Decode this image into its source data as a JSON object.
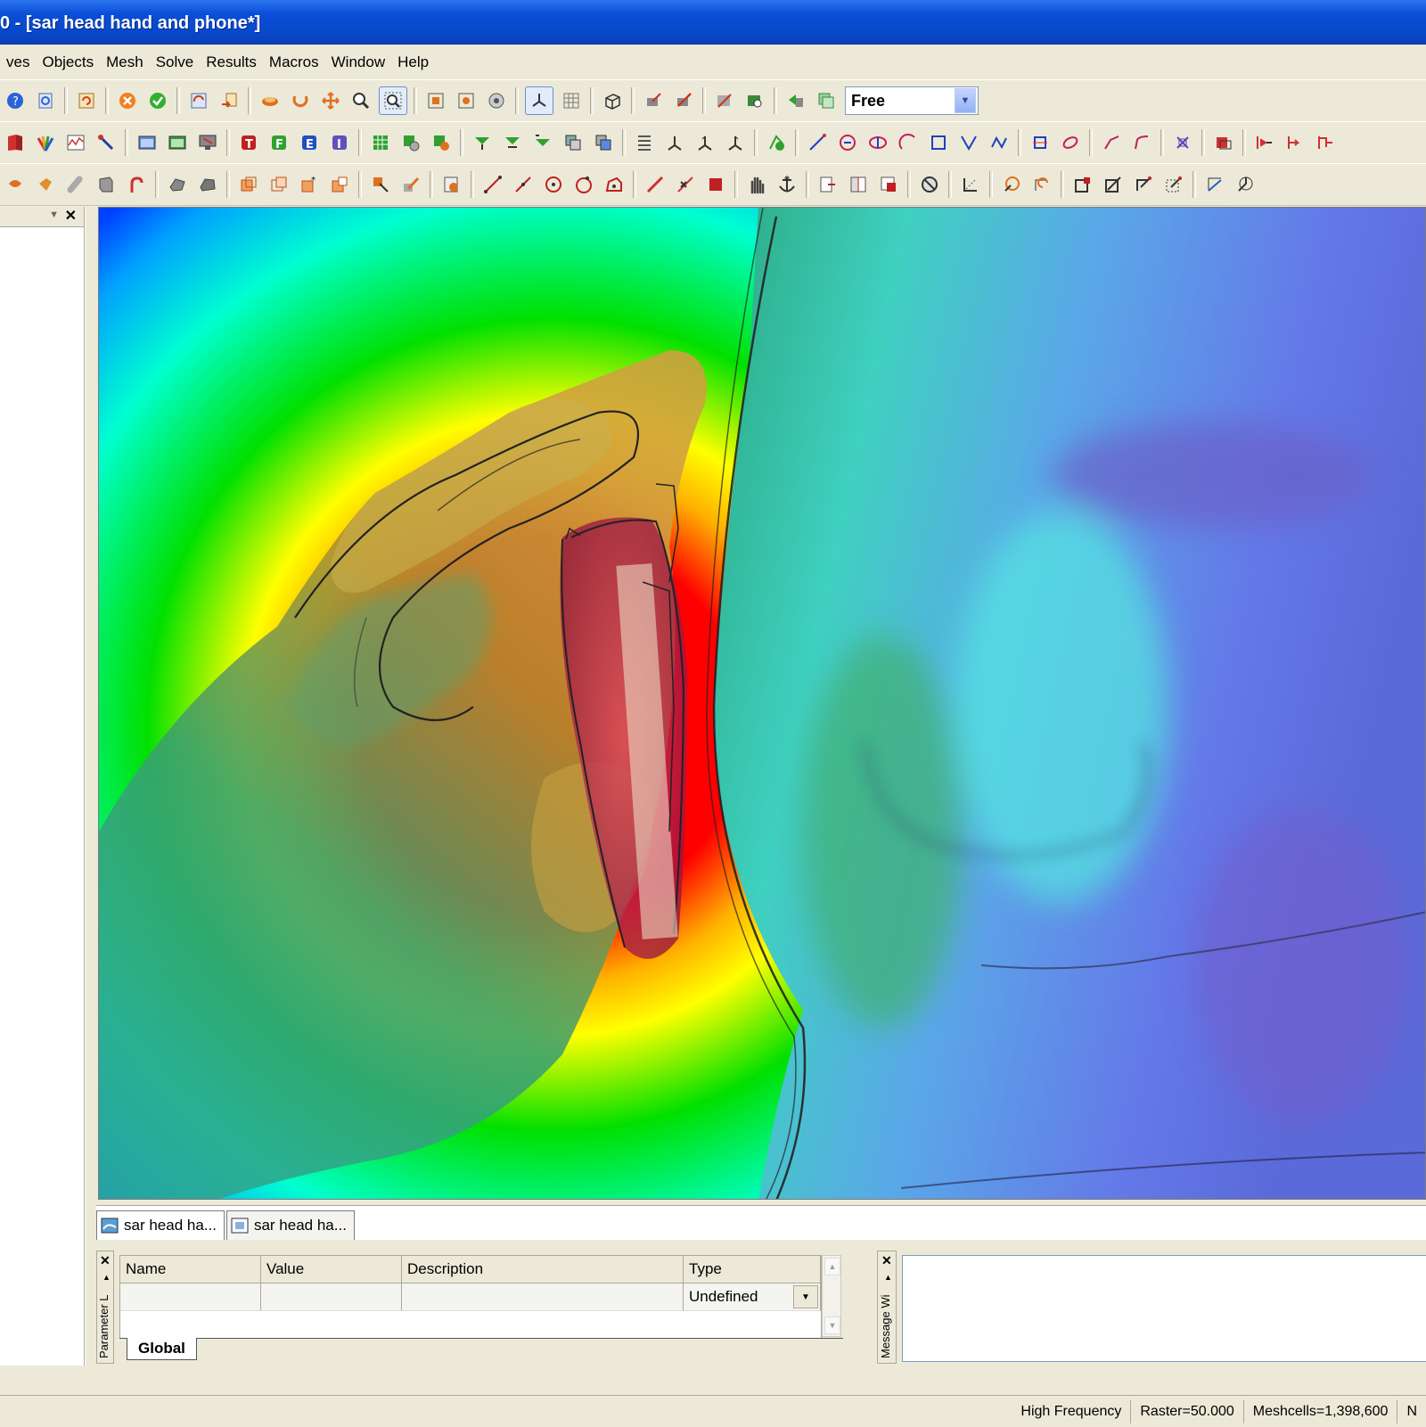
{
  "window": {
    "title": "0 - [sar head hand and phone*]"
  },
  "menu": [
    "ves",
    "Objects",
    "Mesh",
    "Solve",
    "Results",
    "Macros",
    "Window",
    "Help"
  ],
  "toolbar": {
    "view_mode": "Free"
  },
  "tabs": [
    {
      "label": "sar head ha..."
    },
    {
      "label": "sar head ha..."
    }
  ],
  "parameter_list": {
    "panel_label": "Parameter L",
    "columns": [
      "Name",
      "Value",
      "Description",
      "Type"
    ],
    "row": {
      "name": "",
      "value": "",
      "description": "",
      "type": "Undefined"
    },
    "sheet_tab": "Global"
  },
  "message_window": {
    "panel_label": "Message Wi"
  },
  "status": {
    "solver": "High Frequency",
    "raster": "Raster=50.000",
    "meshcells": "Meshcells=1,398,600",
    "extra": "N"
  },
  "colors": {
    "title_bar": "#0846c8",
    "chrome": "#ece9d8",
    "field_red": "#ff0000",
    "field_green": "#00d800",
    "field_blue": "#0060ff"
  }
}
